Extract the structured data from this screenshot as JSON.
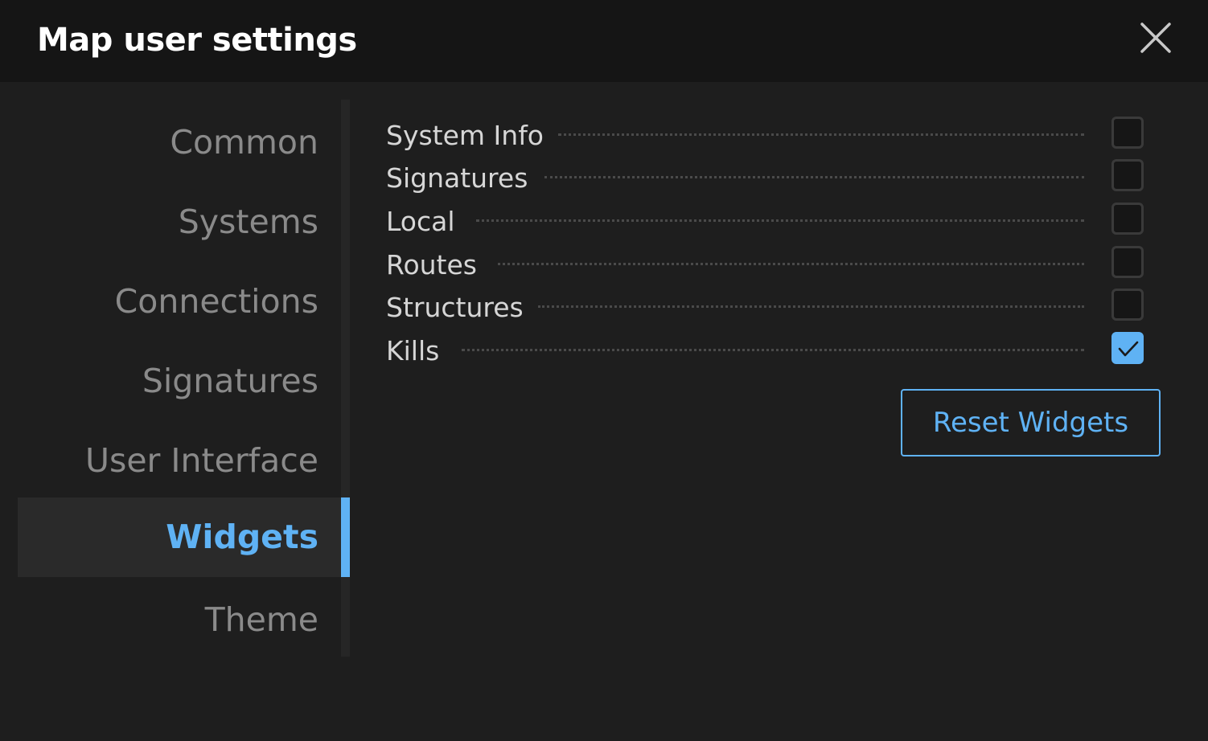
{
  "dialog": {
    "title": "Map user settings",
    "close_icon": "close-icon"
  },
  "sidebar": {
    "items": [
      {
        "label": "Common",
        "active": false
      },
      {
        "label": "Systems",
        "active": false
      },
      {
        "label": "Connections",
        "active": false
      },
      {
        "label": "Signatures",
        "active": false
      },
      {
        "label": "User Interface",
        "active": false
      },
      {
        "label": "Widgets",
        "active": true
      },
      {
        "label": "Theme",
        "active": false
      }
    ]
  },
  "widgets": {
    "rows": [
      {
        "label": "System Info",
        "checked": false
      },
      {
        "label": "Signatures",
        "checked": false
      },
      {
        "label": "Local",
        "checked": false
      },
      {
        "label": "Routes",
        "checked": false
      },
      {
        "label": "Structures",
        "checked": false
      },
      {
        "label": "Kills",
        "checked": true
      }
    ],
    "reset_label": "Reset Widgets"
  },
  "colors": {
    "accent": "#5fb2f4",
    "background": "#1e1e1e",
    "titlebar": "#151515"
  }
}
